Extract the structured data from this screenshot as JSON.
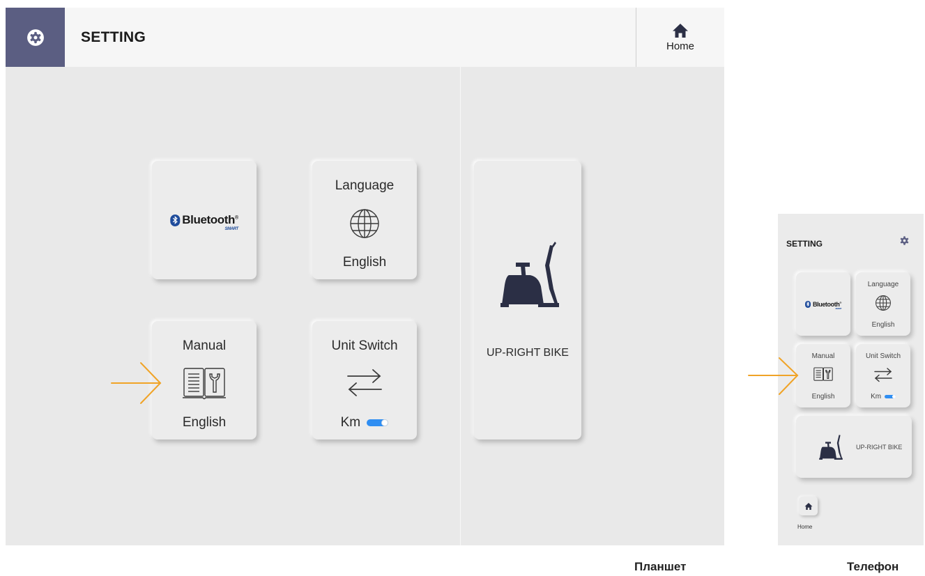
{
  "tablet": {
    "header": {
      "title": "SETTING",
      "home_label": "Home"
    },
    "cards": {
      "bluetooth": {
        "logo_text": "Bluetooth",
        "logo_sub": "SMART",
        "logo_mark": "®"
      },
      "language": {
        "title": "Language",
        "value": "English",
        "icon": "globe-icon"
      },
      "manual": {
        "title": "Manual",
        "value": "English",
        "icon": "manual-book-icon"
      },
      "unit_switch": {
        "title": "Unit Switch",
        "value": "Km",
        "icon": "swap-arrows-icon",
        "toggle_on": true
      },
      "bike": {
        "label": "UP-RIGHT BIKE",
        "icon": "upright-bike-icon"
      }
    },
    "pointer_arrow": "arrow-right-icon"
  },
  "phone": {
    "header": {
      "title": "SETTING"
    },
    "cards": {
      "bluetooth": {
        "logo_text": "Bluetooth",
        "logo_sub": "SMART",
        "logo_mark": "®"
      },
      "language": {
        "title": "Language",
        "value": "English"
      },
      "manual": {
        "title": "Manual",
        "value": "English"
      },
      "unit_switch": {
        "title": "Unit Switch",
        "value": "Km"
      },
      "bike": {
        "label": "UP-RIGHT BIKE"
      }
    },
    "home_label": "Home"
  },
  "captions": {
    "tablet": "Планшет",
    "phone": "Телефон"
  },
  "colors": {
    "accent": "#5b5e82",
    "toggle": "#2f8ef2",
    "bluetooth": "#1e4b9b",
    "arrow": "#f0a326",
    "icon": "#2b2f45"
  }
}
